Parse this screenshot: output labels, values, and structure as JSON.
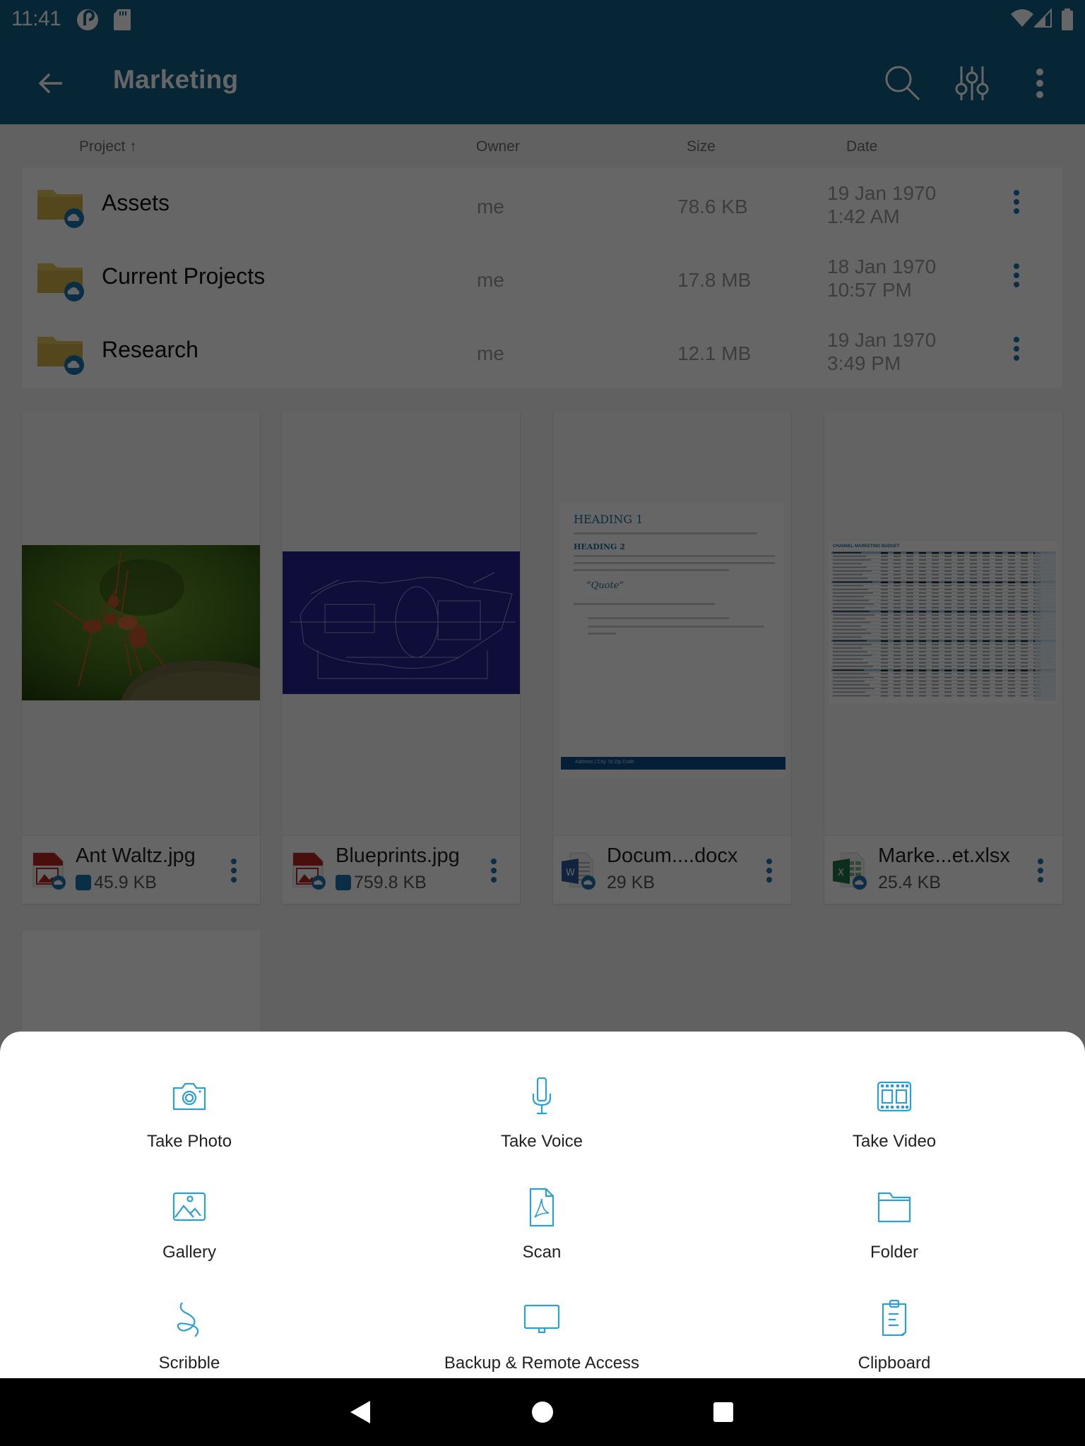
{
  "status_bar": {
    "time": "11:41",
    "left_icons": [
      "pocket-casts-icon",
      "sd-card-icon"
    ],
    "right_icons": [
      "wifi-icon",
      "cellular-signal-icon",
      "battery-icon"
    ]
  },
  "app_bar": {
    "title": "Marketing",
    "back_icon": "arrow-left-icon",
    "actions": [
      "search-icon",
      "filter-sliders-icon",
      "more-vertical-icon"
    ]
  },
  "columns": {
    "project": "Project ↑",
    "owner": "Owner",
    "size": "Size",
    "date": "Date"
  },
  "folders": [
    {
      "name": "Assets",
      "owner": "me",
      "size": "78.6 KB",
      "date": "19 Jan 1970",
      "time": "1:42 AM",
      "cloud": true
    },
    {
      "name": "Current Projects",
      "owner": "me",
      "size": "17.8 MB",
      "date": "18 Jan 1970",
      "time": "10:57 PM",
      "cloud": true
    },
    {
      "name": "Research",
      "owner": "me",
      "size": "12.1 MB",
      "date": "19 Jan 1970",
      "time": "3:49 PM",
      "cloud": true
    }
  ],
  "files": [
    {
      "name": "Ant Waltz.jpg",
      "size": "45.9 KB",
      "type": "image",
      "shared_link": true,
      "cloud": true
    },
    {
      "name": "Blueprints.jpg",
      "size": "759.8 KB",
      "type": "image",
      "shared_link": true,
      "cloud": true
    },
    {
      "name": "Docum....docx",
      "size": "29 KB",
      "type": "word",
      "shared_link": false,
      "cloud": true,
      "preview": {
        "heading1": "HEADING 1",
        "heading2": "HEADING 2",
        "quote": "“Quote”",
        "footer": "Address | City, St Zip Code"
      }
    },
    {
      "name": "Marke...et.xlsx",
      "size": "25.4 KB",
      "type": "excel",
      "shared_link": false,
      "cloud": true,
      "preview": {
        "title": "CHANNEL MARKETING BUDGET"
      }
    }
  ],
  "create_sheet": {
    "options": [
      {
        "label": "Take Photo",
        "icon": "camera-icon"
      },
      {
        "label": "Take Voice",
        "icon": "microphone-icon"
      },
      {
        "label": "Take Video",
        "icon": "film-icon"
      },
      {
        "label": "Gallery",
        "icon": "image-icon"
      },
      {
        "label": "Scan",
        "icon": "pdf-document-icon"
      },
      {
        "label": "Folder",
        "icon": "folder-icon"
      },
      {
        "label": "Scribble",
        "icon": "scribble-icon"
      },
      {
        "label": "Backup & Remote Access",
        "icon": "monitor-icon"
      },
      {
        "label": "Clipboard",
        "icon": "clipboard-icon"
      }
    ]
  },
  "nav_bar": [
    "back-triangle-icon",
    "home-circle-icon",
    "recents-square-icon"
  ],
  "colors": {
    "app_bar": "#0f5f86",
    "accent": "#2a9fd6",
    "kebab": "#1a73b0",
    "folder": "#e2c35a",
    "scrim": "rgba(0,0,0,0.6)"
  }
}
